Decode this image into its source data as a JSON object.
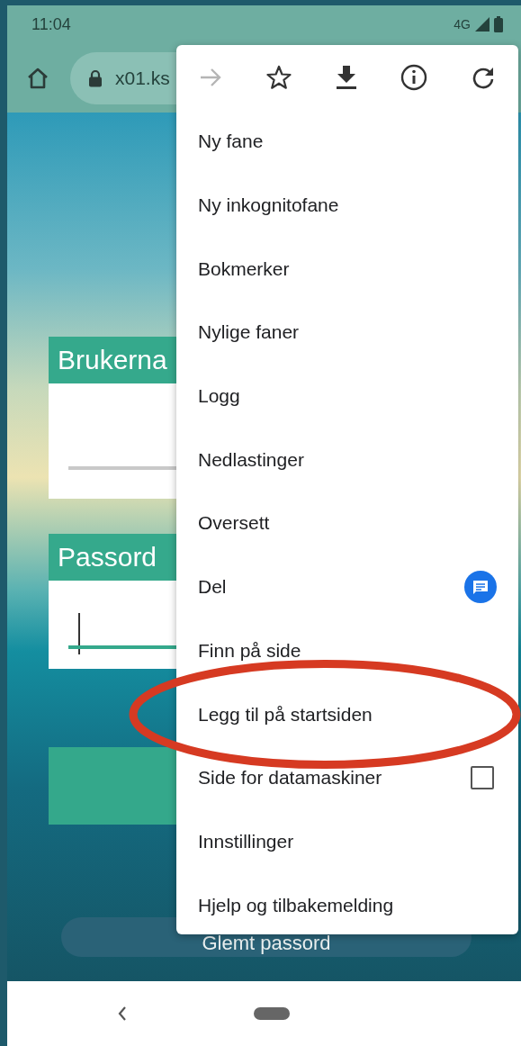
{
  "status_bar": {
    "time": "11:04",
    "network": "4G"
  },
  "toolbar": {
    "url": "x01.ks"
  },
  "page": {
    "fields": [
      {
        "label": "Brukerna",
        "focused": false
      },
      {
        "label": "Passord",
        "focused": true
      }
    ],
    "forgot_button": "Glemt passord"
  },
  "menu": {
    "actions": [
      {
        "kind": "forward",
        "disabled": true
      },
      {
        "kind": "bookmark",
        "disabled": false
      },
      {
        "kind": "download",
        "disabled": false
      },
      {
        "kind": "info",
        "disabled": false
      },
      {
        "kind": "reload",
        "disabled": false
      }
    ],
    "items": [
      {
        "label": "Ny fane",
        "kind": "plain",
        "circled": false
      },
      {
        "label": "Ny inkognitofane",
        "kind": "plain",
        "circled": false
      },
      {
        "label": "Bokmerker",
        "kind": "plain",
        "circled": false
      },
      {
        "label": "Nylige faner",
        "kind": "plain",
        "circled": false
      },
      {
        "label": "Logg",
        "kind": "plain",
        "circled": false
      },
      {
        "label": "Nedlastinger",
        "kind": "plain",
        "circled": false
      },
      {
        "label": "Oversett",
        "kind": "plain",
        "circled": false
      },
      {
        "label": "Del",
        "kind": "share",
        "circled": false
      },
      {
        "label": "Finn på side",
        "kind": "plain",
        "circled": false
      },
      {
        "label": "Legg til på startsiden",
        "kind": "plain",
        "circled": true
      },
      {
        "label": "Side for datamaskiner",
        "kind": "checkbox",
        "checked": false,
        "circled": false
      },
      {
        "label": "Innstillinger",
        "kind": "plain",
        "circled": false
      },
      {
        "label": "Hjelp og tilbakemelding",
        "kind": "plain",
        "circled": false
      }
    ]
  }
}
